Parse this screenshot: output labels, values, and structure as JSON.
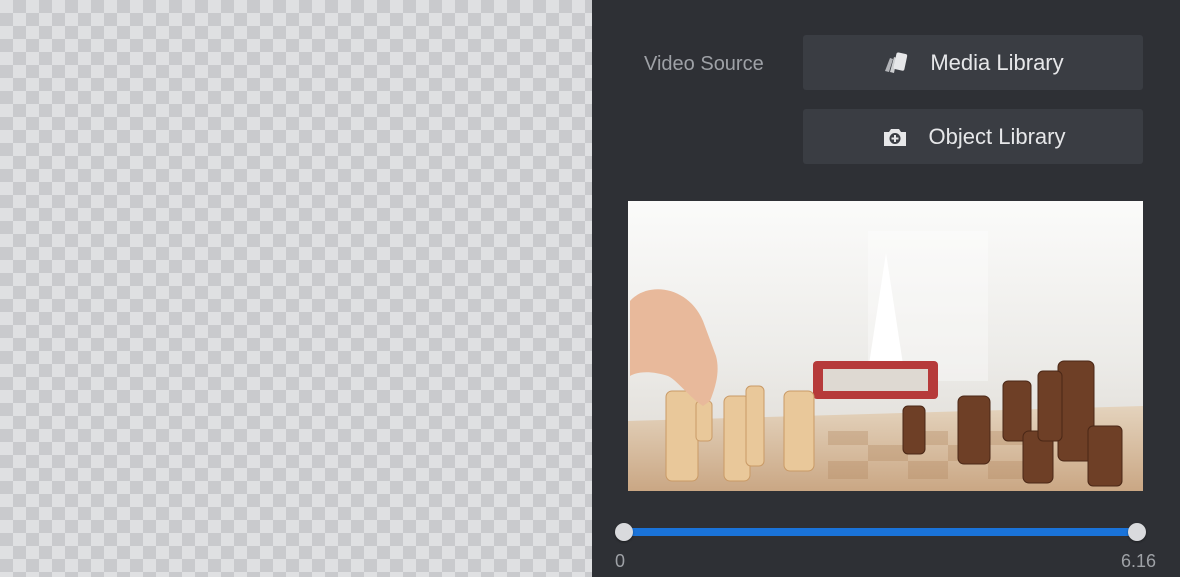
{
  "source": {
    "label": "Video Source",
    "media_library_label": "Media Library",
    "media_library_icon": "media-cards-icon",
    "object_library_label": "Object Library",
    "object_library_icon": "camera-add-icon"
  },
  "trim": {
    "min_label": "0",
    "max_label": "6.16",
    "start": 0,
    "end": 6.16,
    "duration": 6.16
  },
  "colors": {
    "accent": "#1a73d9",
    "panel_bg": "#2e3035",
    "button_bg": "#3a3d43"
  }
}
